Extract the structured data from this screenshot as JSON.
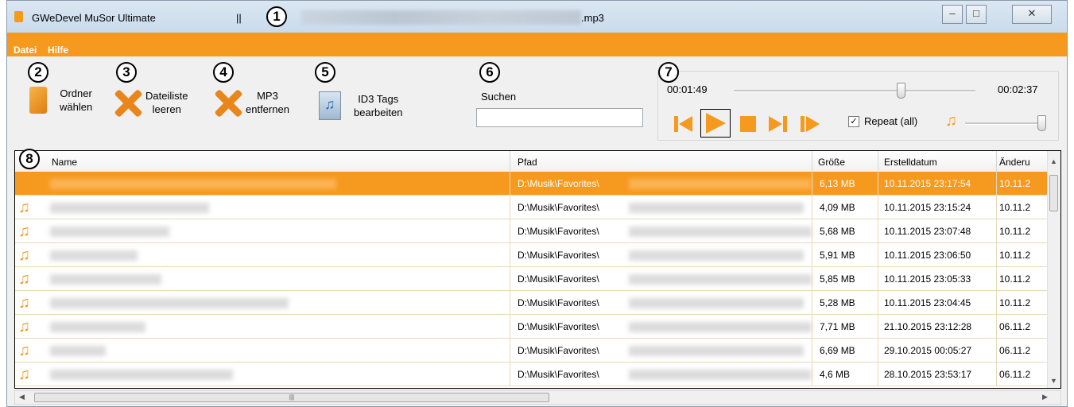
{
  "window": {
    "title": "GWeDevel MuSor Ultimate",
    "title_separator": "||",
    "title_file_ext": ".mp3",
    "controls": {
      "minimize": "–",
      "maximize": "□",
      "close": "✕"
    }
  },
  "callouts": [
    "1",
    "2",
    "3",
    "4",
    "5",
    "6",
    "7",
    "8"
  ],
  "menu": [
    "Datei",
    "Hilfe"
  ],
  "toolbar": {
    "folder": {
      "line1": "Ordner",
      "line2": "wählen",
      "icon": "folder-icon"
    },
    "clear": {
      "line1": "Dateiliste",
      "line2": "leeren",
      "icon": "x-icon"
    },
    "remove": {
      "line1": "MP3",
      "line2": "entfernen",
      "icon": "x-icon"
    },
    "id3": {
      "line1": "ID3 Tags",
      "line2": "bearbeiten",
      "icon": "id3-icon"
    },
    "search": {
      "label": "Suchen",
      "value": ""
    }
  },
  "player": {
    "elapsed": "00:01:49",
    "total": "00:02:37",
    "position_fraction": 0.69,
    "volume_fraction": 1.0,
    "repeat_checked": true,
    "repeat_label": "Repeat (all)",
    "buttons": [
      "previous-icon",
      "play-icon",
      "stop-icon",
      "next-icon",
      "skip-icon"
    ]
  },
  "table": {
    "columns": [
      "Name",
      "Pfad",
      "Größe",
      "Erstelldatum",
      "Änderu"
    ],
    "rows": [
      {
        "path": "D:\\Musik\\Favorites\\",
        "size": "6,13 MB",
        "created": "10.11.2015 23:17:54",
        "modified": "10.11.2",
        "selected": true
      },
      {
        "path": "D:\\Musik\\Favorites\\",
        "size": "4,09 MB",
        "created": "10.11.2015 23:15:24",
        "modified": "10.11.2",
        "selected": false
      },
      {
        "path": "D:\\Musik\\Favorites\\",
        "size": "5,68 MB",
        "created": "10.11.2015 23:07:48",
        "modified": "10.11.2",
        "selected": false
      },
      {
        "path": "D:\\Musik\\Favorites\\",
        "size": "5,91 MB",
        "created": "10.11.2015 23:06:50",
        "modified": "10.11.2",
        "selected": false
      },
      {
        "path": "D:\\Musik\\Favorites\\",
        "size": "5,85 MB",
        "created": "10.11.2015 23:05:33",
        "modified": "10.11.2",
        "selected": false
      },
      {
        "path": "D:\\Musik\\Favorites\\",
        "size": "5,28 MB",
        "created": "10.11.2015 23:04:45",
        "modified": "10.11.2",
        "selected": false
      },
      {
        "path": "D:\\Musik\\Favorites\\",
        "size": "7,71 MB",
        "created": "21.10.2015 23:12:28",
        "modified": "06.11.2",
        "selected": false
      },
      {
        "path": "D:\\Musik\\Favorites\\",
        "size": "6,69 MB",
        "created": "29.10.2015 00:05:27",
        "modified": "06.11.2",
        "selected": false
      },
      {
        "path": "D:\\Musik\\Favorites\\",
        "size": "4,6 MB",
        "created": "28.10.2015 23:53:17",
        "modified": "06.11.2",
        "selected": false
      }
    ]
  },
  "colors": {
    "accent": "#f59a1e",
    "selected_row": "#f59a1e"
  }
}
